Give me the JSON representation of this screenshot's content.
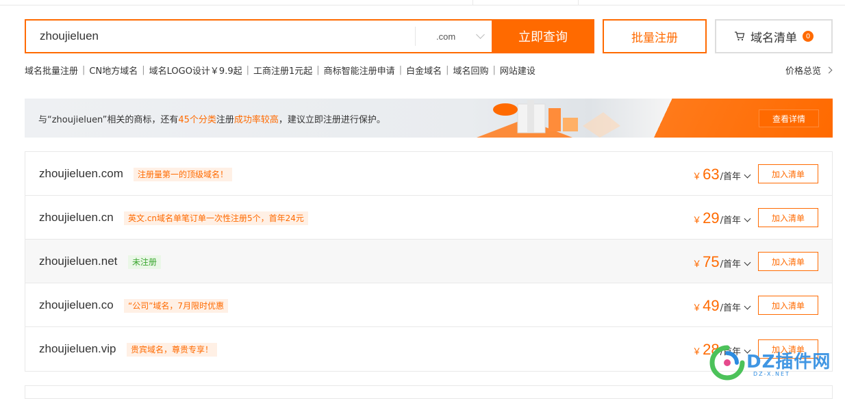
{
  "search": {
    "value": "zhoujieluen",
    "tld": ".com",
    "button": "立即查询"
  },
  "bulk_register": "批量注册",
  "cart": {
    "label": "域名清单",
    "count": "0"
  },
  "quick_links": [
    "域名批量注册",
    "CN地方域名",
    "域名LOGO设计￥9.9起",
    "工商注册1元起",
    "商标智能注册申请",
    "白金域名",
    "域名回购",
    "网站建设"
  ],
  "price_overview": "价格总览",
  "banner": {
    "text_a": "与“zhoujieluen”相关的商标，还有",
    "hl_a": "45个分类",
    "text_b": "注册",
    "hl_b": "成功率较高",
    "text_c": "，建议立即注册进行保护。",
    "button": "查看详情"
  },
  "results": [
    {
      "domain": "zhoujieluen.com",
      "tag": "注册量第一的顶级域名！",
      "tag_style": "orange",
      "currency": "￥",
      "price": "63",
      "unit": "/首年",
      "add": "加入清单"
    },
    {
      "domain": "zhoujieluen.cn",
      "tag": "英文.cn域名单笔订单一次性注册5个，首年24元",
      "tag_style": "orange",
      "currency": "￥",
      "price": "29",
      "unit": "/首年",
      "add": "加入清单"
    },
    {
      "domain": "zhoujieluen.net",
      "tag": "未注册",
      "tag_style": "green",
      "currency": "￥",
      "price": "75",
      "unit": "/首年",
      "add": "加入清单"
    },
    {
      "domain": "zhoujieluen.co",
      "tag": "“公司”域名，7月限时优惠",
      "tag_style": "orange",
      "currency": "￥",
      "price": "49",
      "unit": "/首年",
      "add": "加入清单"
    },
    {
      "domain": "zhoujieluen.vip",
      "tag": "贵宾域名，尊贵专享！",
      "tag_style": "orange",
      "currency": "￥",
      "price": "28",
      "unit": "/首年",
      "add": "加入清单"
    }
  ],
  "watermark": {
    "text": "DZ插件网",
    "sub": "DZ-X.NET"
  },
  "colors": {
    "accent": "#ff6a00",
    "green": "#3aa62f"
  }
}
